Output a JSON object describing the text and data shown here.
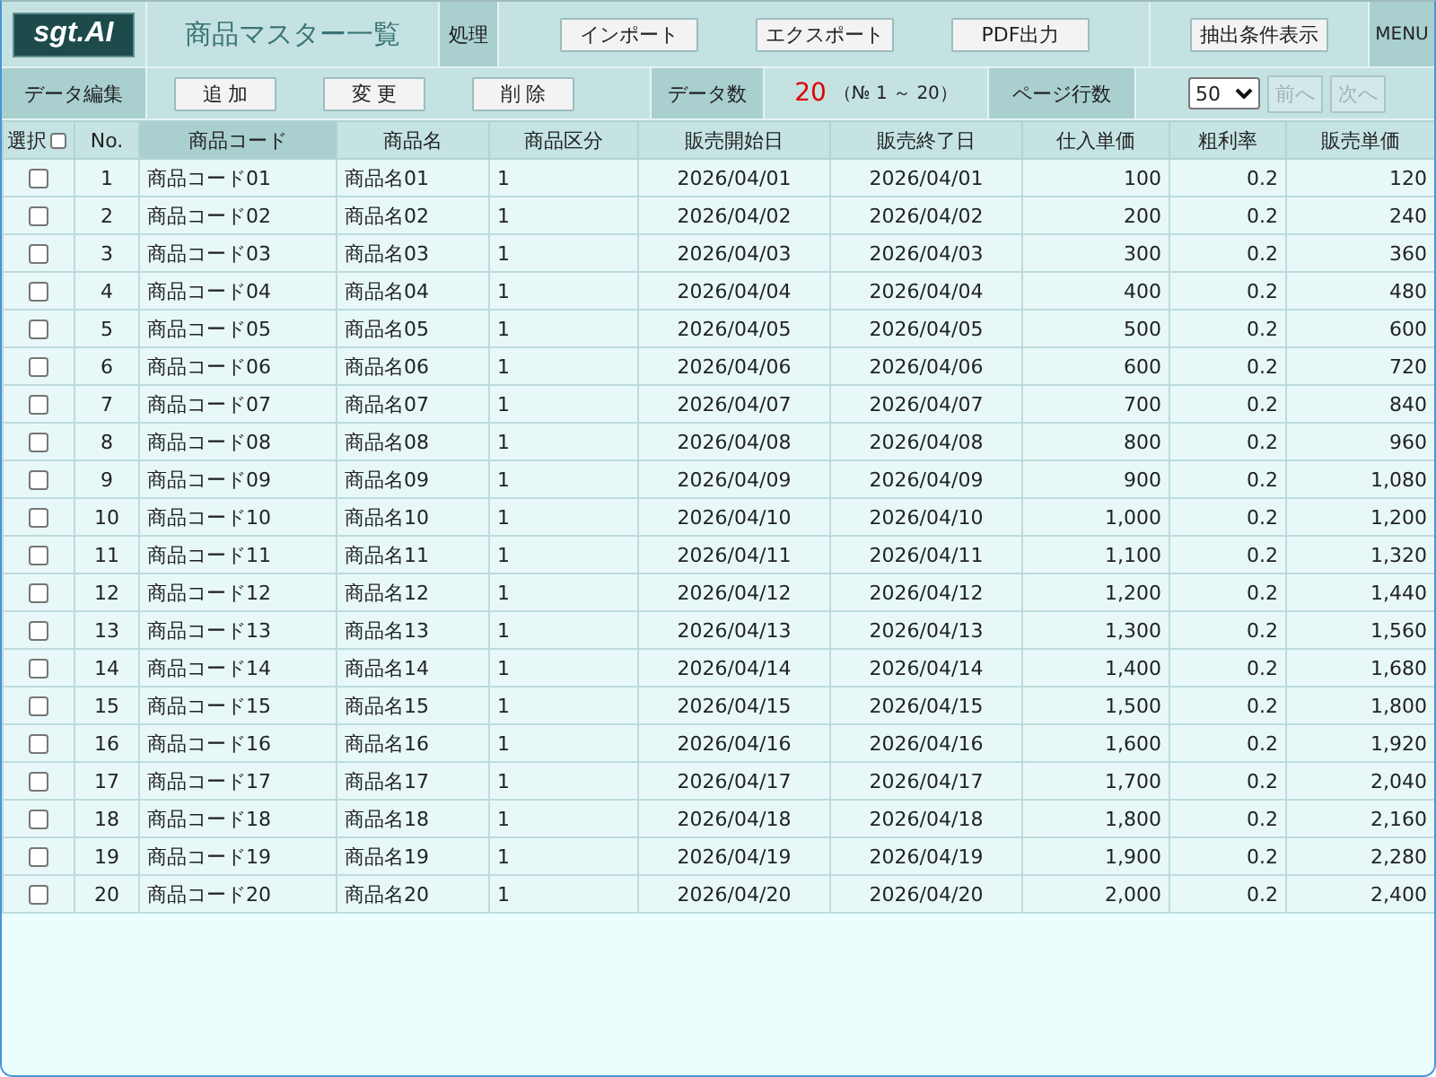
{
  "header": {
    "logo": "sgt.AI",
    "title": "商品マスター一覧",
    "section_label": "処理",
    "actions": [
      {
        "label": "インポート"
      },
      {
        "label": "エクスポート"
      },
      {
        "label": "PDF出力"
      }
    ],
    "filter_button": "抽出条件表示",
    "menu": "MENU"
  },
  "toolbar": {
    "section_label": "データ編集",
    "buttons": [
      {
        "label": "追 加"
      },
      {
        "label": "変 更"
      },
      {
        "label": "削 除"
      }
    ],
    "count_label": "データ数",
    "count": "20",
    "range": "（№ 1 ～ 20）",
    "page_rows_label": "ページ行数",
    "page_rows": "50",
    "prev": {
      "label": "前へ",
      "disabled": true
    },
    "next": {
      "label": "次へ",
      "disabled": true
    }
  },
  "table": {
    "select_all": {
      "label": "選択",
      "checked": false
    },
    "columns": [
      {
        "label": "No.",
        "kind": "index",
        "selected": false
      },
      {
        "label": "商品コード",
        "kind": "text",
        "selected": true
      },
      {
        "label": "商品名",
        "kind": "text",
        "selected": false
      },
      {
        "label": "商品区分",
        "kind": "text",
        "selected": false
      },
      {
        "label": "販売開始日",
        "kind": "date",
        "selected": false
      },
      {
        "label": "販売終了日",
        "kind": "date",
        "selected": false
      },
      {
        "label": "仕入単価",
        "kind": "number",
        "selected": false
      },
      {
        "label": "粗利率",
        "kind": "number",
        "selected": false
      },
      {
        "label": "販売単価",
        "kind": "number",
        "selected": false
      }
    ],
    "rows": [
      {
        "checked": false,
        "cells": [
          "1",
          "商品コード01",
          "商品名01",
          "1",
          "2026/04/01",
          "2026/04/01",
          "100",
          "0.2",
          "120"
        ]
      },
      {
        "checked": false,
        "cells": [
          "2",
          "商品コード02",
          "商品名02",
          "1",
          "2026/04/02",
          "2026/04/02",
          "200",
          "0.2",
          "240"
        ]
      },
      {
        "checked": false,
        "cells": [
          "3",
          "商品コード03",
          "商品名03",
          "1",
          "2026/04/03",
          "2026/04/03",
          "300",
          "0.2",
          "360"
        ]
      },
      {
        "checked": false,
        "cells": [
          "4",
          "商品コード04",
          "商品名04",
          "1",
          "2026/04/04",
          "2026/04/04",
          "400",
          "0.2",
          "480"
        ]
      },
      {
        "checked": false,
        "cells": [
          "5",
          "商品コード05",
          "商品名05",
          "1",
          "2026/04/05",
          "2026/04/05",
          "500",
          "0.2",
          "600"
        ]
      },
      {
        "checked": false,
        "cells": [
          "6",
          "商品コード06",
          "商品名06",
          "1",
          "2026/04/06",
          "2026/04/06",
          "600",
          "0.2",
          "720"
        ]
      },
      {
        "checked": false,
        "cells": [
          "7",
          "商品コード07",
          "商品名07",
          "1",
          "2026/04/07",
          "2026/04/07",
          "700",
          "0.2",
          "840"
        ]
      },
      {
        "checked": false,
        "cells": [
          "8",
          "商品コード08",
          "商品名08",
          "1",
          "2026/04/08",
          "2026/04/08",
          "800",
          "0.2",
          "960"
        ]
      },
      {
        "checked": false,
        "cells": [
          "9",
          "商品コード09",
          "商品名09",
          "1",
          "2026/04/09",
          "2026/04/09",
          "900",
          "0.2",
          "1,080"
        ]
      },
      {
        "checked": false,
        "cells": [
          "10",
          "商品コード10",
          "商品名10",
          "1",
          "2026/04/10",
          "2026/04/10",
          "1,000",
          "0.2",
          "1,200"
        ]
      },
      {
        "checked": false,
        "cells": [
          "11",
          "商品コード11",
          "商品名11",
          "1",
          "2026/04/11",
          "2026/04/11",
          "1,100",
          "0.2",
          "1,320"
        ]
      },
      {
        "checked": false,
        "cells": [
          "12",
          "商品コード12",
          "商品名12",
          "1",
          "2026/04/12",
          "2026/04/12",
          "1,200",
          "0.2",
          "1,440"
        ]
      },
      {
        "checked": false,
        "cells": [
          "13",
          "商品コード13",
          "商品名13",
          "1",
          "2026/04/13",
          "2026/04/13",
          "1,300",
          "0.2",
          "1,560"
        ]
      },
      {
        "checked": false,
        "cells": [
          "14",
          "商品コード14",
          "商品名14",
          "1",
          "2026/04/14",
          "2026/04/14",
          "1,400",
          "0.2",
          "1,680"
        ]
      },
      {
        "checked": false,
        "cells": [
          "15",
          "商品コード15",
          "商品名15",
          "1",
          "2026/04/15",
          "2026/04/15",
          "1,500",
          "0.2",
          "1,800"
        ]
      },
      {
        "checked": false,
        "cells": [
          "16",
          "商品コード16",
          "商品名16",
          "1",
          "2026/04/16",
          "2026/04/16",
          "1,600",
          "0.2",
          "1,920"
        ]
      },
      {
        "checked": false,
        "cells": [
          "17",
          "商品コード17",
          "商品名17",
          "1",
          "2026/04/17",
          "2026/04/17",
          "1,700",
          "0.2",
          "2,040"
        ]
      },
      {
        "checked": false,
        "cells": [
          "18",
          "商品コード18",
          "商品名18",
          "1",
          "2026/04/18",
          "2026/04/18",
          "1,800",
          "0.2",
          "2,160"
        ]
      },
      {
        "checked": false,
        "cells": [
          "19",
          "商品コード19",
          "商品名19",
          "1",
          "2026/04/19",
          "2026/04/19",
          "1,900",
          "0.2",
          "2,280"
        ]
      },
      {
        "checked": false,
        "cells": [
          "20",
          "商品コード20",
          "商品名20",
          "1",
          "2026/04/20",
          "2026/04/20",
          "2,000",
          "0.2",
          "2,400"
        ]
      }
    ]
  }
}
